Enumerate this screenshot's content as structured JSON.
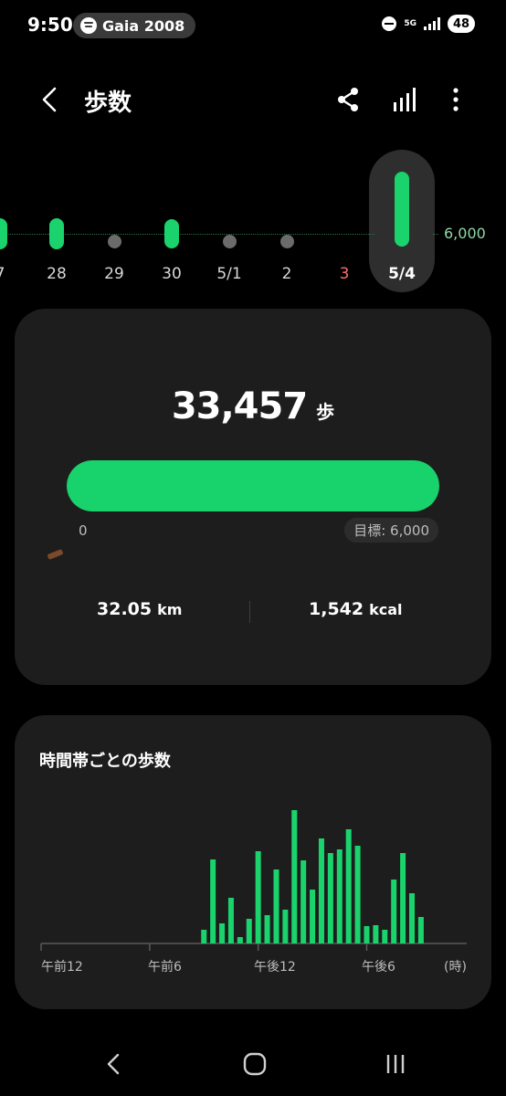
{
  "status_bar": {
    "time": "9:50",
    "media_label": "Gaia 2008",
    "network": "5G",
    "battery": "48"
  },
  "header": {
    "title": "歩数"
  },
  "date_strip": {
    "goal_label": "6,000",
    "days": [
      {
        "label": "7",
        "level": 0.35,
        "recorded": true
      },
      {
        "label": "28",
        "level": 0.32,
        "recorded": true
      },
      {
        "label": "29",
        "level": 0,
        "recorded": false
      },
      {
        "label": "30",
        "level": 0.24,
        "recorded": true
      },
      {
        "label": "5/1",
        "level": 0,
        "recorded": false
      },
      {
        "label": "2",
        "level": 0,
        "recorded": false
      },
      {
        "label": "3",
        "level": 0,
        "recorded": false
      },
      {
        "label": "5/4",
        "level": 1.0,
        "recorded": true
      }
    ],
    "selected_index": 7,
    "colors": {
      "bar": "#1ad36d",
      "sunday": "#ff6b6b",
      "no_data": "#6b6b6b"
    }
  },
  "summary": {
    "steps_value": "33,457",
    "steps_unit": "歩",
    "progress_fraction": 1.0,
    "progress_min_label": "0",
    "goal_label": "目標: 6,000",
    "distance_value": "32.05",
    "distance_unit": "km",
    "calories_value": "1,542",
    "calories_unit": "kcal"
  },
  "hourly": {
    "title": "時間帯ごとの歩数",
    "chart_data": {
      "type": "bar",
      "title": "時間帯ごとの歩数",
      "xlabel": "(時)",
      "ylabel": "",
      "x_tick_labels": [
        "午前12",
        "午前6",
        "午後12",
        "午後6",
        "(時)"
      ],
      "x": [
        9.0,
        9.5,
        10.0,
        10.5,
        11.0,
        11.5,
        12.0,
        12.5,
        13.0,
        13.5,
        14.0,
        14.5,
        15.0,
        15.5,
        16.0,
        16.5,
        17.0,
        17.5,
        18.0,
        18.5,
        19.0,
        19.5,
        20.0,
        20.5,
        21.0,
        21.5
      ],
      "values": [
        15,
        92,
        22,
        50,
        7,
        27,
        101,
        31,
        81,
        37,
        146,
        91,
        59,
        115,
        99,
        103,
        125,
        107,
        19,
        20,
        15,
        70,
        99,
        55,
        29,
        0
      ],
      "ylim": [
        0,
        150
      ],
      "grid": false,
      "color": "#1ad36d"
    }
  }
}
